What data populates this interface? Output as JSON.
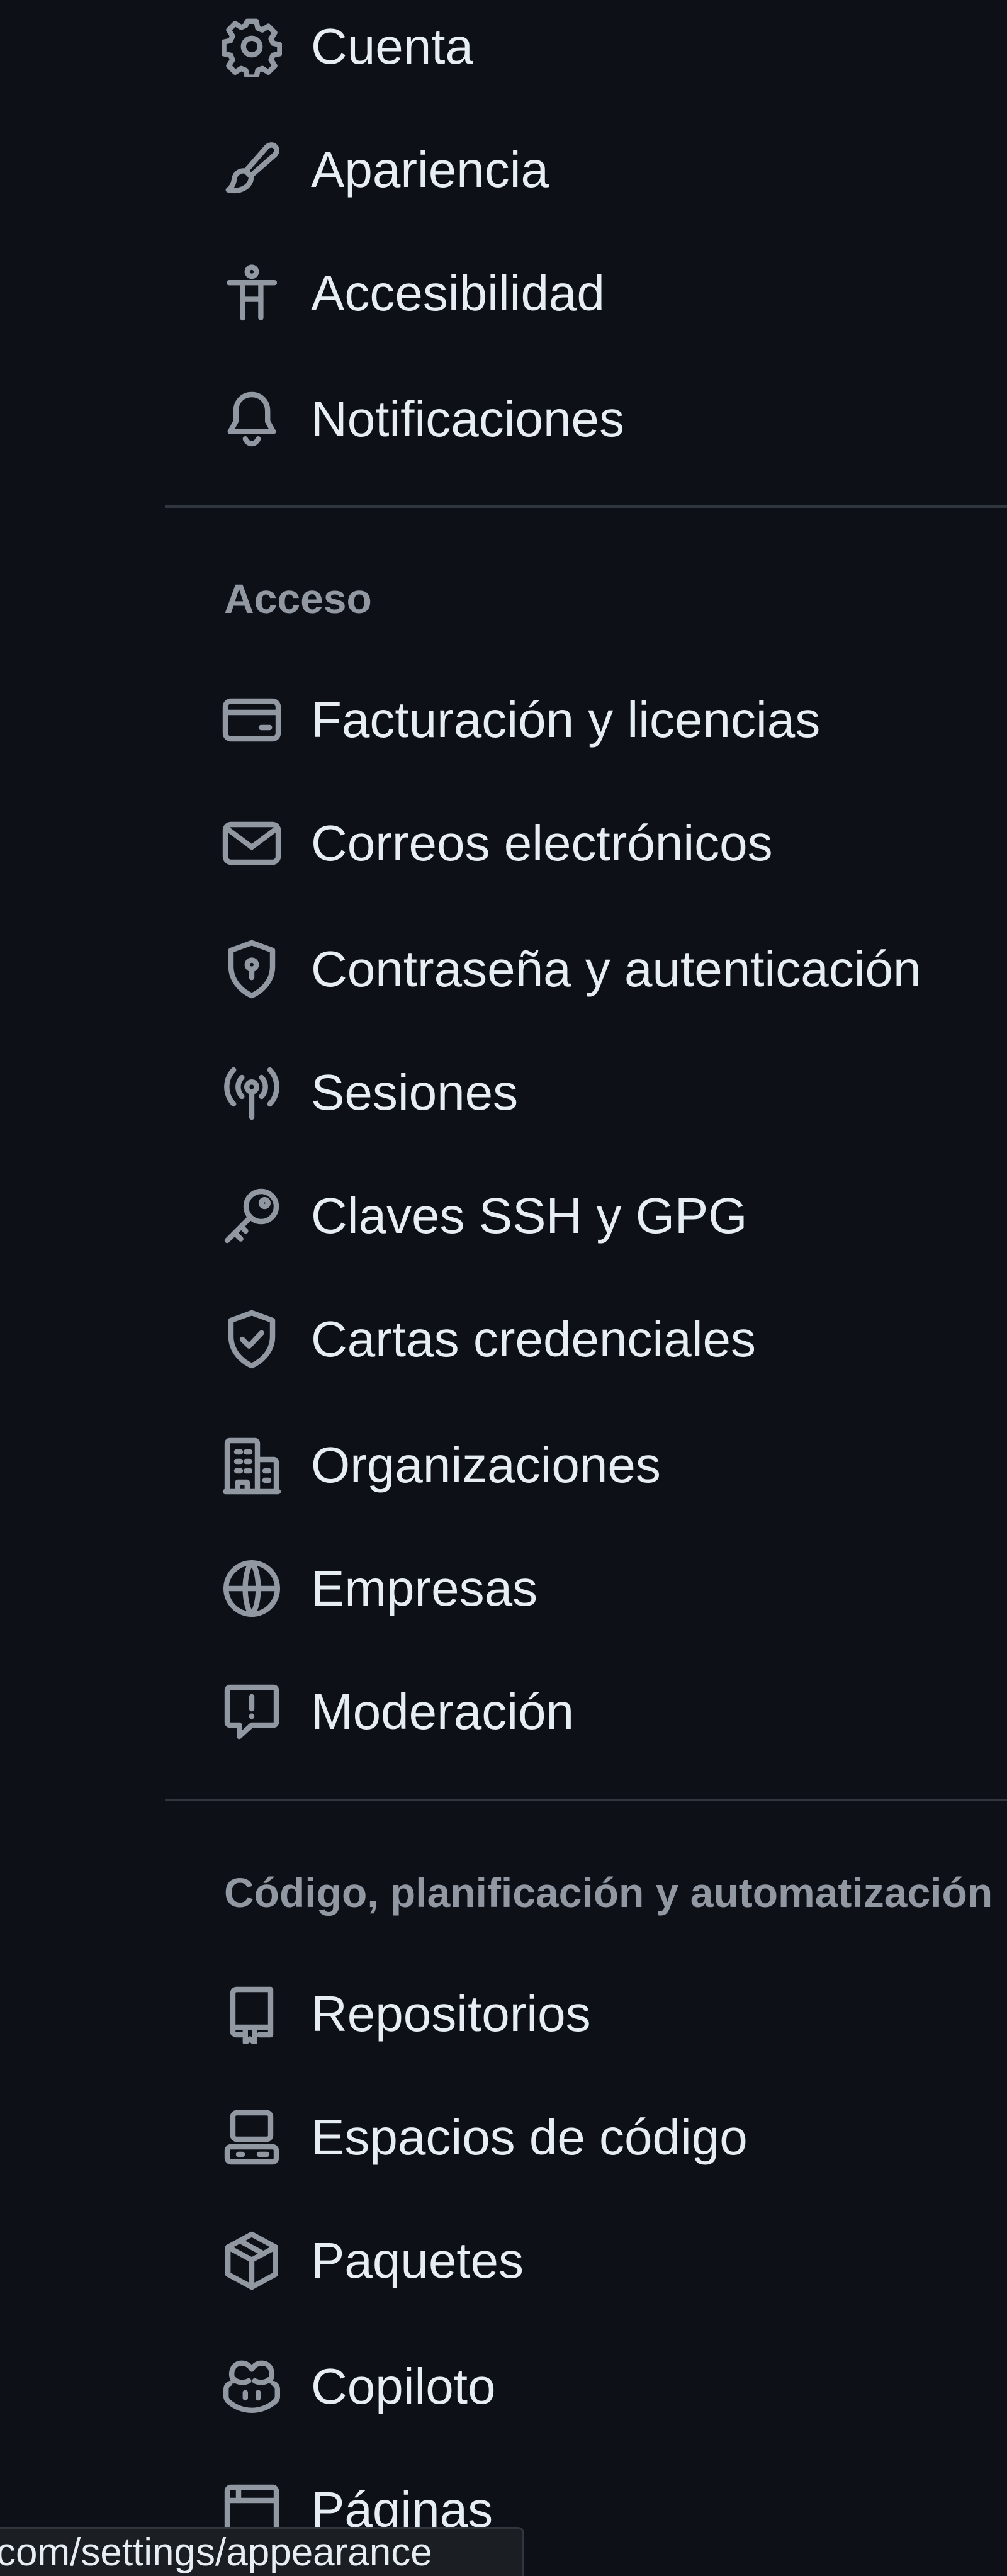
{
  "sidebar": {
    "top_items": [
      {
        "label": "Cuenta",
        "icon": "gear-icon"
      },
      {
        "label": "Apariencia",
        "icon": "paintbrush-icon"
      },
      {
        "label": "Accesibilidad",
        "icon": "accessibility-icon"
      },
      {
        "label": "Notificaciones",
        "icon": "bell-icon"
      }
    ],
    "access_heading": "Acceso",
    "access_items": [
      {
        "label": "Facturación y licencias",
        "icon": "credit-card-icon"
      },
      {
        "label": "Correos electrónicos",
        "icon": "mail-icon"
      },
      {
        "label": "Contraseña y autenticación",
        "icon": "shield-lock-icon"
      },
      {
        "label": "Sesiones",
        "icon": "broadcast-icon"
      },
      {
        "label": "Claves SSH y GPG",
        "icon": "key-icon"
      },
      {
        "label": "Cartas credenciales",
        "icon": "shield-check-icon"
      },
      {
        "label": "Organizaciones",
        "icon": "organization-icon"
      },
      {
        "label": "Empresas",
        "icon": "globe-icon"
      },
      {
        "label": "Moderación",
        "icon": "report-icon"
      }
    ],
    "code_heading": "Código, planificación y automatización",
    "code_items": [
      {
        "label": "Repositorios",
        "icon": "repo-icon"
      },
      {
        "label": "Espacios de código",
        "icon": "codespaces-icon"
      },
      {
        "label": "Paquetes",
        "icon": "package-icon"
      },
      {
        "label": "Copiloto",
        "icon": "copilot-icon"
      },
      {
        "label": "Páginas",
        "icon": "browser-icon"
      }
    ]
  },
  "status_bar": {
    "url": "com/settings/appearance"
  }
}
